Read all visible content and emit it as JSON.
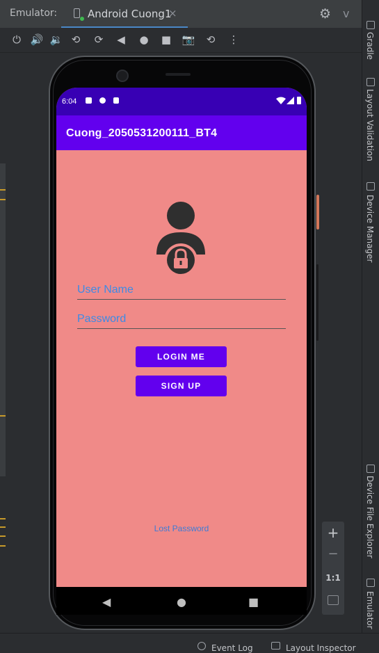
{
  "ide": {
    "tool_window_label": "Emulator:",
    "tab_title": "Android Cuong1",
    "tab_close": "×",
    "more": "v",
    "right_tabs": [
      "Gradle",
      "Layout Validation",
      "Device Manager",
      "Device File Explorer",
      "Emulator"
    ],
    "status_items": [
      "Event Log",
      "Layout Inspector"
    ],
    "zoom": {
      "in": "+",
      "out": "−",
      "ratio": "1:1"
    },
    "toolbar_icons": [
      "power-icon",
      "volume-up-icon",
      "volume-down-icon",
      "rotate-left-icon",
      "rotate-right-icon",
      "back-icon",
      "home-icon",
      "overview-icon",
      "camera-icon",
      "snapshot-icon",
      "more-icon"
    ]
  },
  "device": {
    "status_time": "6:04",
    "app_title": "Cuong_2050531200111_BT4",
    "username_hint": "User Name",
    "password_hint": "Password",
    "login_label": "LOGIN ME",
    "signup_label": "SIGN UP",
    "lost_password": "Lost Password"
  },
  "colors": {
    "screen_bg": "#f08a88",
    "app_bar": "#6200ee",
    "status_bar": "#3800b4",
    "hint_text": "#3d8ae6"
  }
}
